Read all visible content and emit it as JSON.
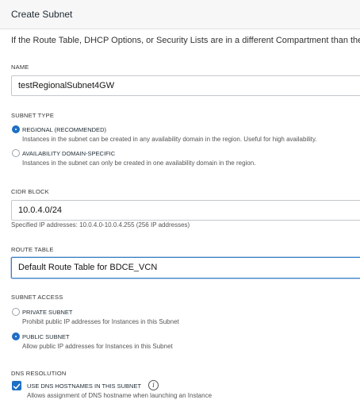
{
  "dialog": {
    "title": "Create Subnet",
    "notice": "If the Route Table, DHCP Options, or Security Lists are in a different Compartment than the Su"
  },
  "name": {
    "label": "NAME",
    "value": "testRegionalSubnet4GW"
  },
  "subnet_type": {
    "label": "SUBNET TYPE",
    "options": [
      {
        "title": "REGIONAL (RECOMMENDED)",
        "desc": "Instances in the subnet can be created in any availability domain in the region. Useful for high availability.",
        "selected": true
      },
      {
        "title": "AVAILABILITY DOMAIN-SPECIFIC",
        "desc": "Instances in the subnet can only be created in one availability domain in the region.",
        "selected": false
      }
    ]
  },
  "cidr": {
    "label": "CIDR BLOCK",
    "value": "10.0.4.0/24",
    "help": "Specified IP addresses: 10.0.4.0-10.0.4.255 (256 IP addresses)"
  },
  "route_table": {
    "label": "ROUTE TABLE",
    "value": "Default Route Table for BDCE_VCN"
  },
  "subnet_access": {
    "label": "SUBNET ACCESS",
    "options": [
      {
        "title": "PRIVATE SUBNET",
        "desc": "Prohibit public IP addresses for Instances in this Subnet",
        "selected": false
      },
      {
        "title": "PUBLIC SUBNET",
        "desc": "Allow public IP addresses for Instances in this Subnet",
        "selected": true
      }
    ]
  },
  "dns": {
    "label": "DNS RESOLUTION",
    "checkbox_label": "USE DNS HOSTNAMES IN THIS SUBNET",
    "checked": true,
    "help": "Allows assignment of DNS hostname when launching an Instance",
    "info_glyph": "i",
    "info_icon": "info-circle-icon",
    "check_icon": "checkmark-icon"
  },
  "colors": {
    "accent": "#1f6fc5",
    "focus_border": "#3b7fc4",
    "title_bar": "#f7f7f7",
    "field_border": "#c4c8cc"
  }
}
